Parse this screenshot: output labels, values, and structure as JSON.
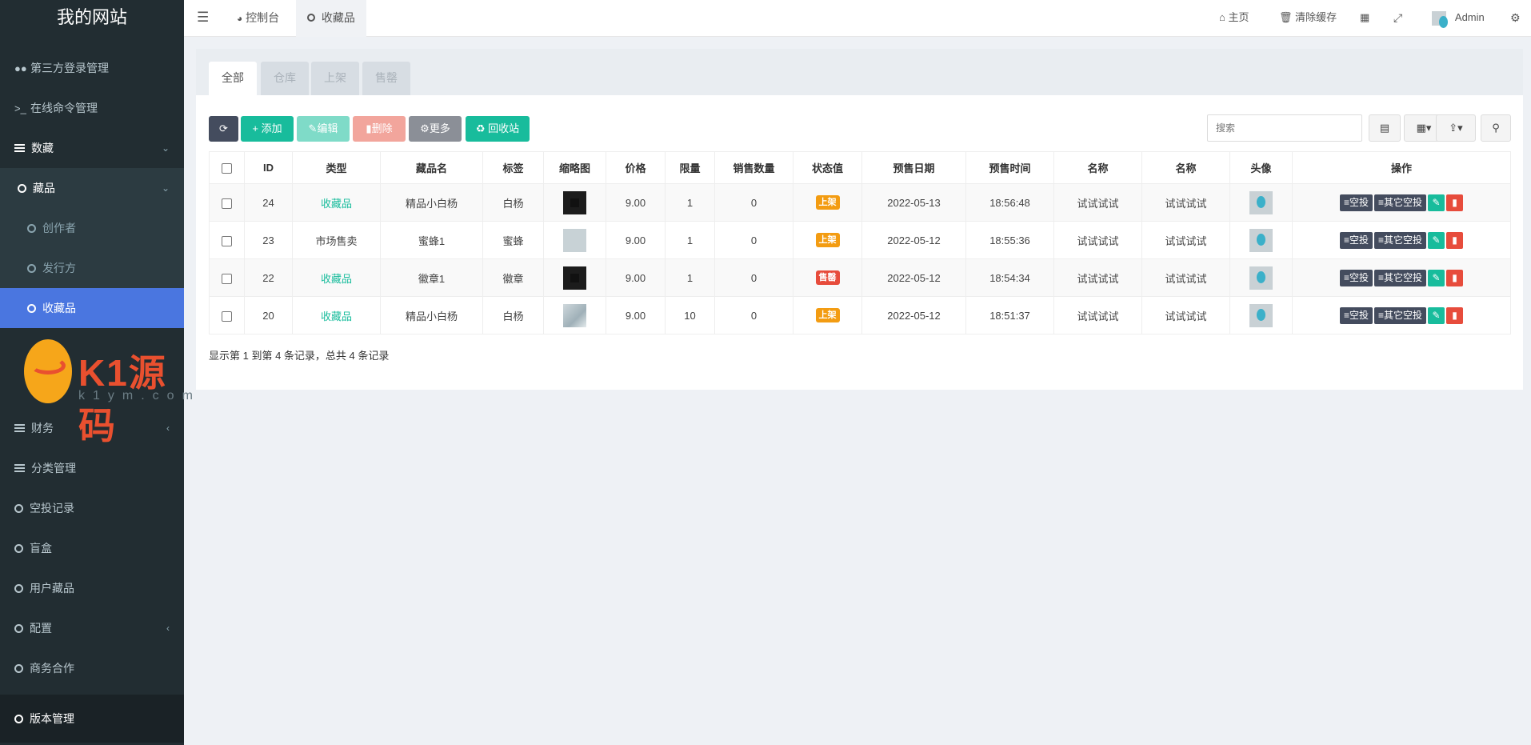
{
  "site": {
    "title": "我的网站"
  },
  "sidebar": {
    "items": [
      {
        "label": "第三方登录管理"
      },
      {
        "label": "在线命令管理"
      },
      {
        "label": "数藏"
      },
      {
        "label": "藏品"
      },
      {
        "label": "创作者"
      },
      {
        "label": "发行方"
      },
      {
        "label": "收藏品"
      },
      {
        "label": "财务"
      },
      {
        "label": "分类管理"
      },
      {
        "label": "空投记录"
      },
      {
        "label": "盲盒"
      },
      {
        "label": "用户藏品"
      },
      {
        "label": "配置"
      },
      {
        "label": "商务合作"
      },
      {
        "label": "版本管理"
      }
    ]
  },
  "watermark": {
    "text": "K1源码",
    "sub": "k1ym.com"
  },
  "topnav": {
    "dashboard": "控制台",
    "current_tab": "收藏品",
    "home": "主页",
    "clear_cache": "清除缓存",
    "user": "Admin"
  },
  "tabs": [
    "全部",
    "仓库",
    "上架",
    "售罄"
  ],
  "toolbar": {
    "add": "添加",
    "edit": "编辑",
    "delete": "删除",
    "more": "更多",
    "recycle": "回收站",
    "search_placeholder": "搜索"
  },
  "table": {
    "headers": [
      "ID",
      "类型",
      "藏品名",
      "标签",
      "缩略图",
      "价格",
      "限量",
      "销售数量",
      "状态值",
      "预售日期",
      "预售时间",
      "名称",
      "名称",
      "头像",
      "操作"
    ],
    "rows": [
      {
        "id": "24",
        "type": "收藏品",
        "name": "精品小白杨",
        "tag": "白杨",
        "price": "9.00",
        "limit": "1",
        "sold": "0",
        "status": "上架",
        "date": "2022-05-13",
        "time": "18:56:48",
        "name1": "试试试试",
        "name2": "试试试试"
      },
      {
        "id": "23",
        "type": "市场售卖",
        "name": "蜜蜂1",
        "tag": "蜜蜂",
        "price": "9.00",
        "limit": "1",
        "sold": "0",
        "status": "上架",
        "date": "2022-05-12",
        "time": "18:55:36",
        "name1": "试试试试",
        "name2": "试试试试"
      },
      {
        "id": "22",
        "type": "收藏品",
        "name": "徽章1",
        "tag": "徽章",
        "price": "9.00",
        "limit": "1",
        "sold": "0",
        "status": "售罄",
        "date": "2022-05-12",
        "time": "18:54:34",
        "name1": "试试试试",
        "name2": "试试试试"
      },
      {
        "id": "20",
        "type": "收藏品",
        "name": "精品小白杨",
        "tag": "白杨",
        "price": "9.00",
        "limit": "10",
        "sold": "0",
        "status": "上架",
        "date": "2022-05-12",
        "time": "18:51:37",
        "name1": "试试试试",
        "name2": "试试试试"
      }
    ],
    "op_airdrop": "空投",
    "op_other_airdrop": "其它空投"
  },
  "pagination": {
    "info": "显示第 1 到第 4 条记录，总共 4 条记录"
  },
  "colors": {
    "accent": "#18bc9c",
    "sidebar": "#222d32",
    "active": "#4a76e0",
    "warning": "#f39c12",
    "danger": "#e74c3c",
    "dark_button": "#444c5e"
  }
}
